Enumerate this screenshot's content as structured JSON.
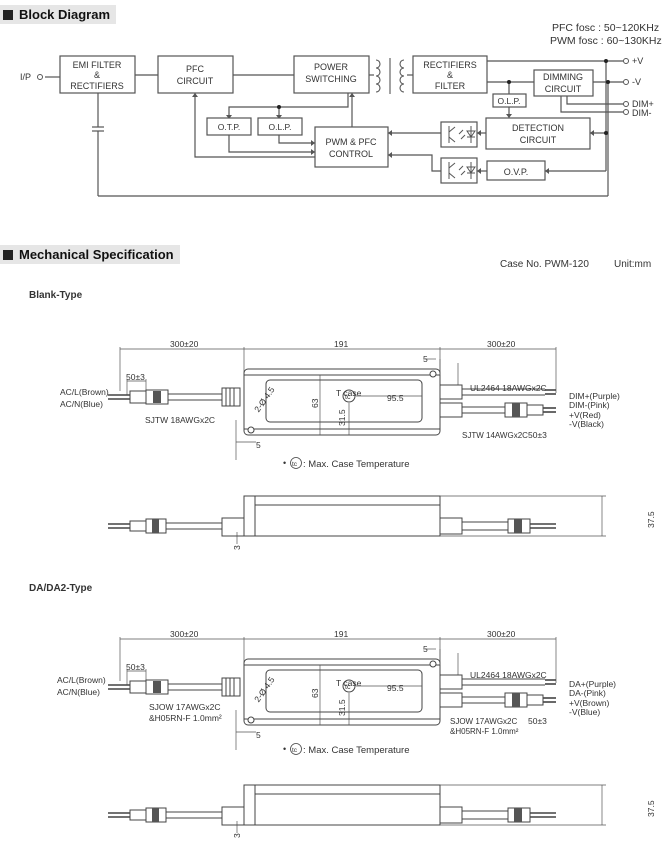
{
  "block_diagram": {
    "section_title": "Block Diagram",
    "osc_notes": [
      "PFC fosc : 50~120KHz",
      "PWM fosc : 60~130KHz"
    ],
    "input_label": "I/P",
    "blocks": {
      "emi": [
        "EMI FILTER",
        "&",
        "RECTIFIERS"
      ],
      "pfc": [
        "PFC",
        "CIRCUIT"
      ],
      "power_switching": [
        "POWER",
        "SWITCHING"
      ],
      "rectifiers": [
        "RECTIFIERS",
        "&",
        "FILTER"
      ],
      "dimming": [
        "DIMMING",
        "CIRCUIT"
      ],
      "olp_right": "O.L.P.",
      "otp": "O.T.P.",
      "olp_left": "O.L.P.",
      "pwm_pfc": [
        "PWM & PFC",
        "CONTROL"
      ],
      "detection": [
        "DETECTION",
        "CIRCUIT"
      ],
      "ovp": "O.V.P."
    },
    "outputs": [
      "+V",
      "-V",
      "DIM+",
      "DIM-"
    ]
  },
  "mechanical": {
    "section_title": "Mechanical Specification",
    "case_no": "Case No. PWM-120",
    "unit": "Unit:mm",
    "tc_note": ": Max. Case Temperature",
    "tc_symbol": "tc",
    "types": [
      {
        "title": "Blank-Type",
        "dim_left_cable": "300±20",
        "dim_body": "191",
        "dim_right_cable": "300±20",
        "dim_strip_left": "50±3",
        "dim_strip_right": "50±3",
        "dim_width": "63",
        "dim_half_width": "31.5",
        "dim_tcase": "95.5",
        "tcase_label": "T case",
        "hole_label": "2-Ø 4.5",
        "dim_hole": "5",
        "dim_side_height": "37.5",
        "dim_side_offset": "3",
        "input_wires": [
          "AC/L(Brown)",
          "AC/N(Blue)"
        ],
        "input_cable": [
          "SJTW 18AWGx2C"
        ],
        "dim_cable": "UL2464 18AWGx2C",
        "dim_wires": [
          "DIM+(Purple)",
          "DIM-(Pink)"
        ],
        "output_wires": [
          "+V(Red)",
          "-V(Black)"
        ],
        "output_cable": [
          "SJTW 14AWGx2C"
        ]
      },
      {
        "title": "DA/DA2-Type",
        "dim_left_cable": "300±20",
        "dim_body": "191",
        "dim_right_cable": "300±20",
        "dim_strip_left": "50±3",
        "dim_strip_right": "50±3",
        "dim_width": "63",
        "dim_half_width": "31.5",
        "dim_tcase": "95.5",
        "tcase_label": "T case",
        "hole_label": "2-Ø 4.5",
        "dim_hole": "5",
        "dim_side_height": "37.5",
        "dim_side_offset": "3",
        "input_wires": [
          "AC/L(Brown)",
          "AC/N(Blue)"
        ],
        "input_cable": [
          "SJOW 17AWGx2C",
          "&H05RN-F 1.0mm²"
        ],
        "dim_cable": "UL2464 18AWGx2C",
        "dim_wires": [
          "DA+(Purple)",
          "DA-(Pink)"
        ],
        "output_wires": [
          "+V(Brown)",
          "-V(Blue)"
        ],
        "output_cable": [
          "SJOW 17AWGx2C",
          "&H05RN-F 1.0mm²"
        ]
      }
    ]
  },
  "colors": {
    "line": "#555555",
    "header_bg": "#e6e6e6",
    "text": "#333333"
  }
}
